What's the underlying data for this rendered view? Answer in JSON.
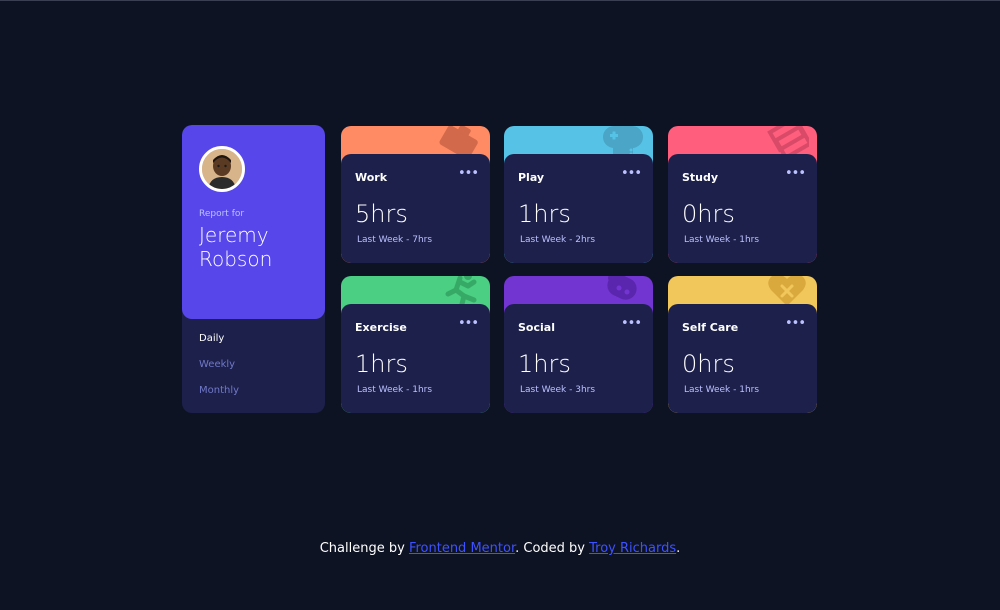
{
  "profile": {
    "report_for": "Report for",
    "name": "Jeremy Robson",
    "periods": [
      "Daily",
      "Weekly",
      "Monthly"
    ],
    "active_period": "Daily"
  },
  "cards": [
    {
      "title": "Work",
      "hours": "5hrs",
      "previous": "Last Week - 7hrs",
      "color": "#ff8b64",
      "icon": "briefcase-icon"
    },
    {
      "title": "Play",
      "hours": "1hrs",
      "previous": "Last Week - 2hrs",
      "color": "#55c2e6",
      "icon": "gamepad-icon"
    },
    {
      "title": "Study",
      "hours": "0hrs",
      "previous": "Last Week - 1hrs",
      "color": "#ff5e7d",
      "icon": "book-icon"
    },
    {
      "title": "Exercise",
      "hours": "1hrs",
      "previous": "Last Week - 1hrs",
      "color": "#4bcf82",
      "icon": "running-icon"
    },
    {
      "title": "Social",
      "hours": "1hrs",
      "previous": "Last Week - 3hrs",
      "color": "#7335d2",
      "icon": "social-icon"
    },
    {
      "title": "Self Care",
      "hours": "0hrs",
      "previous": "Last Week - 1hrs",
      "color": "#f1c75b",
      "icon": "heart-icon"
    }
  ],
  "footer": {
    "prefix": "Challenge by ",
    "link1": "Frontend Mentor",
    "middle": ". Coded by ",
    "link2": "Troy Richards",
    "suffix": "."
  },
  "colors": {
    "background": "#0e1324",
    "card": "#1c204b",
    "accent": "#5747ea",
    "link": "#3e52ff"
  }
}
